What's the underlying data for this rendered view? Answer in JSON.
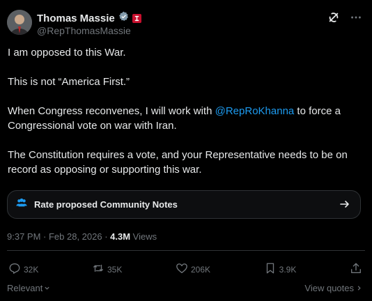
{
  "author": {
    "name": "Thomas Massie",
    "handle": "@RepThomasMassie"
  },
  "post": {
    "paragraphs": [
      "I am opposed to this War.",
      "This is not “America First.”",
      {
        "before": "When Congress reconvenes, I will work with ",
        "mention": "@RepRoKhanna",
        "after": " to force a Congressional vote on war with Iran."
      },
      "The Constitution requires a vote, and your Representative needs to be on record as opposing or supporting this war."
    ]
  },
  "community_notes": {
    "label": "Rate proposed Community Notes"
  },
  "meta": {
    "timestamp": "9:37 PM · Feb 28, 2026 · ",
    "views_count": "4.3M",
    "views_label": " Views"
  },
  "actions": {
    "replies": "32K",
    "reposts": "35K",
    "likes": "206K",
    "bookmarks": "3.9K"
  },
  "footer": {
    "sort_label": "Relevant",
    "quotes_label": "View quotes"
  },
  "colors": {
    "accent": "#1d9bf0",
    "verified_badge": "#829aab",
    "flag": "#c8102e"
  },
  "icons": [
    "grok-icon",
    "more-icon",
    "verified-badge-icon",
    "flag-icon",
    "people-icon",
    "arrow-right-icon",
    "reply-icon",
    "repost-icon",
    "like-icon",
    "bookmark-icon",
    "share-icon",
    "chevron-down-icon",
    "chevron-right-icon"
  ]
}
